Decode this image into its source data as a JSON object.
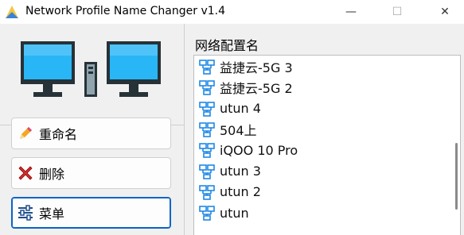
{
  "window": {
    "title": "Network Profile Name Changer v1.4",
    "controls": {
      "minimize": "—",
      "maximize": "☐",
      "close": "✕"
    }
  },
  "actions": [
    {
      "label": "重命名",
      "icon": "pencil-icon"
    },
    {
      "label": "删除",
      "icon": "red-x-icon"
    },
    {
      "label": "菜单",
      "icon": "sliders-icon"
    }
  ],
  "profiles": {
    "label": "网络配置名",
    "items": [
      "益捷云-5G 3",
      "益捷云-5G 2",
      "utun 4",
      "504上",
      "iQOO 10 Pro",
      "utun 3",
      "utun 2",
      "utun"
    ]
  },
  "colors": {
    "accent": "#0a64c8",
    "monitor_screen": "#29b6f6",
    "monitor_frame": "#263238",
    "net_icon": "#1e88e5"
  }
}
